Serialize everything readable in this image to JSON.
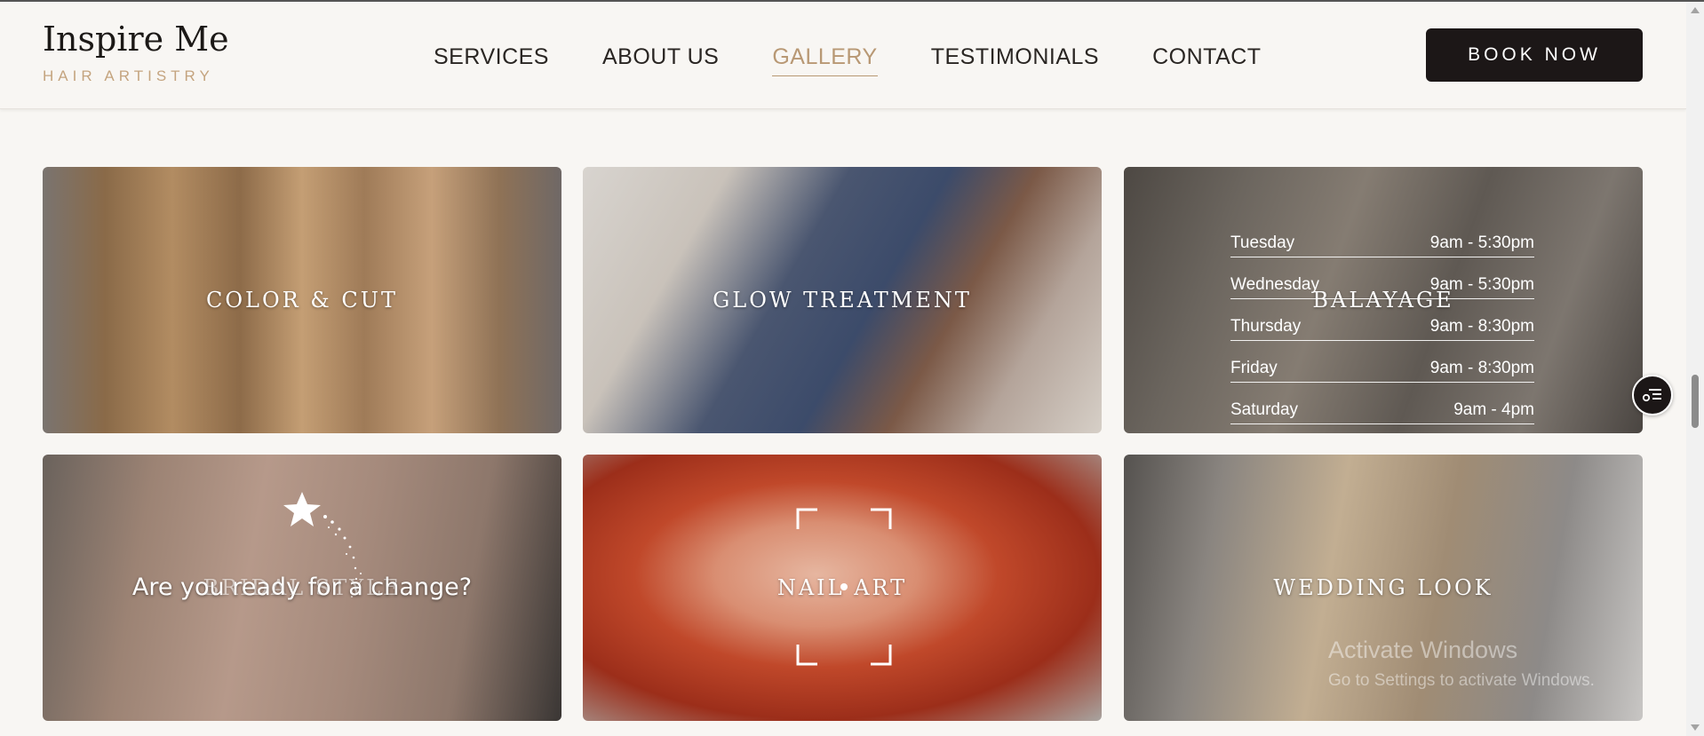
{
  "brand": {
    "title": "Inspire Me",
    "subtitle": "HAIR ARTISTRY"
  },
  "nav": {
    "items": [
      {
        "label": "SERVICES",
        "active": false
      },
      {
        "label": "ABOUT US",
        "active": false
      },
      {
        "label": "GALLERY",
        "active": true
      },
      {
        "label": "TESTIMONIALS",
        "active": false
      },
      {
        "label": "CONTACT",
        "active": false
      }
    ],
    "book_label": "BOOK NOW"
  },
  "gallery": {
    "tiles": [
      {
        "label": "COLOR & CUT"
      },
      {
        "label": "GLOW TREATMENT"
      },
      {
        "label": "BALAYAGE"
      },
      {
        "label": "BRIDAL STYLE"
      },
      {
        "label": "NAIL ART"
      },
      {
        "label": "WEDDING LOOK"
      }
    ]
  },
  "hours": [
    {
      "day": "Tuesday",
      "time": "9am - 5:30pm"
    },
    {
      "day": "Wednesday",
      "time": "9am - 5:30pm"
    },
    {
      "day": "Thursday",
      "time": "9am - 8:30pm"
    },
    {
      "day": "Friday",
      "time": "9am - 8:30pm"
    },
    {
      "day": "Saturday",
      "time": "9am - 4pm"
    }
  ],
  "promo_text": "Are you ready for a change?",
  "watermark": {
    "title": "Activate Windows",
    "subtitle": "Go to Settings to activate Windows."
  },
  "colors": {
    "accent": "#b89874",
    "brand_dark": "#1c1717",
    "background": "#f8f6f3"
  },
  "icons": {
    "float_button": "menu-list-icon",
    "sparkle": "shooting-star-icon"
  }
}
